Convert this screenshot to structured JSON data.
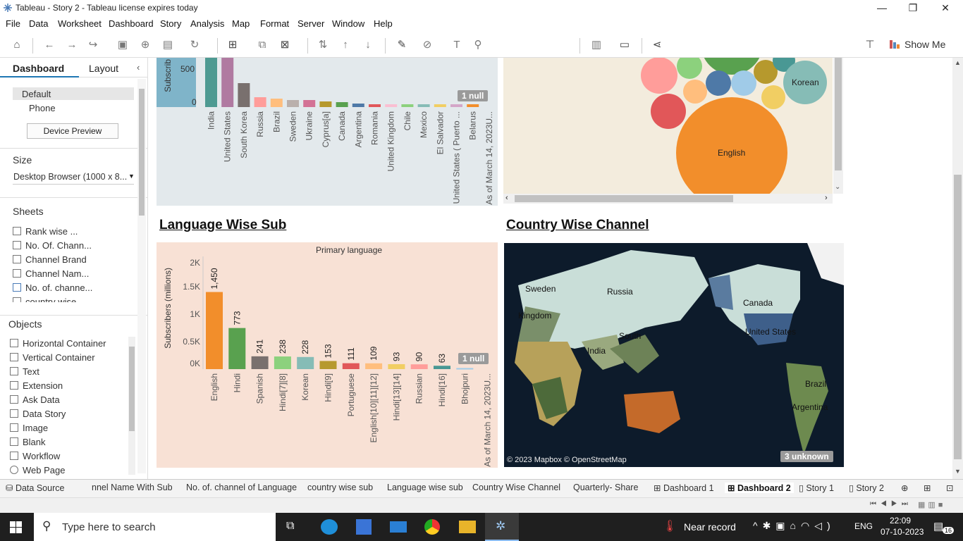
{
  "window": {
    "title": "Tableau - Story 2 - Tableau license expires today"
  },
  "menu": [
    "File",
    "Data",
    "Worksheet",
    "Dashboard",
    "Story",
    "Analysis",
    "Map",
    "Format",
    "Server",
    "Window",
    "Help"
  ],
  "toolbar": {
    "show_me": "Show Me"
  },
  "left_pane": {
    "tabs": [
      "Dashboard",
      "Layout"
    ],
    "devices": [
      "Default",
      "Phone"
    ],
    "device_preview": "Device Preview",
    "size_header": "Size",
    "size_value": "Desktop Browser (1000 x 8...",
    "sheets_header": "Sheets",
    "sheets": [
      "Rank wise ...",
      "No. Of. Chann...",
      "Channel Brand",
      "Channel Nam...",
      "No. of. channe...",
      "country wise ..."
    ],
    "objects_header": "Objects",
    "objects": [
      "Horizontal Container",
      "Vertical Container",
      "Text",
      "Extension",
      "Ask Data",
      "Data Story",
      "Image",
      "Blank",
      "Workflow",
      "Web Page"
    ]
  },
  "top_chart": {
    "y_label": "Subscrib",
    "ticks": [
      "500",
      "0"
    ],
    "countries": [
      "India",
      "United States",
      "South Korea",
      "Russia",
      "Brazil",
      "Sweden",
      "Ukraine",
      "Cyprus[a]",
      "Canada",
      "Argentina",
      "Romania",
      "United Kingdom",
      "Chile",
      "Mexico",
      "El Salvador",
      "United States ( Puerto ...",
      "Belarus",
      "As of March 14, 2023U..."
    ],
    "null_badge": "1 null"
  },
  "bubble": {
    "labels": [
      "Korean",
      "English"
    ]
  },
  "headings": {
    "language": "Language Wise Sub",
    "country": "Country Wise Channel"
  },
  "chart_data": {
    "type": "bar",
    "title": "Primary language",
    "ylabel": "Subscribers (millions)",
    "yticks": [
      "2K",
      "1.5K",
      "1K",
      "0.5K",
      "0K"
    ],
    "ylim": [
      0,
      2000
    ],
    "categories": [
      "English",
      "Hindi",
      "Spanish",
      "Hindi[7][8]",
      "Korean",
      "Hindi[9]",
      "Portuguese",
      "English[10][11][12]",
      "Hindi[13][14]",
      "Russian",
      "Hindi[16]",
      "Bhojpuri",
      "As of March 14, 2023U..."
    ],
    "values": [
      1450,
      773,
      241,
      238,
      228,
      153,
      111,
      109,
      93,
      90,
      63,
      20,
      null
    ],
    "labels": [
      "1,450",
      "773",
      "241",
      "238",
      "228",
      "153",
      "111",
      "109",
      "93",
      "90",
      "63",
      "",
      ""
    ],
    "colors": [
      "#f28e2b",
      "#59a14f",
      "#79706e",
      "#8cd17d",
      "#86bcb6",
      "#b6992d",
      "#e15759",
      "#ffbe7d",
      "#f1ce63",
      "#ff9d9a",
      "#499894",
      "#a0cbe8",
      "#ffffff"
    ],
    "null_badge": "1 null"
  },
  "map": {
    "labels": [
      "Russia",
      "Canada",
      "United States",
      "South",
      "India",
      "Brazil",
      "Argentina",
      "Sweden",
      "Kingdom"
    ],
    "attribution": "© 2023 Mapbox © OpenStreetMap",
    "unknown_badge": "3 unknown"
  },
  "sheet_tabs": [
    "Data Source",
    "nnel Name With Sub",
    "No. of. channel of Language",
    "country wise sub",
    "Language wise sub",
    "Country Wise Channel",
    "Quarterly- Share",
    "Dashboard 1",
    "Dashboard 2",
    "Story 1",
    "Story 2"
  ],
  "taskbar": {
    "search_placeholder": "Type here to search",
    "weather": "Near record",
    "lang": "ENG",
    "time": "22:09",
    "date": "07-10-2023",
    "notifications": "16"
  }
}
